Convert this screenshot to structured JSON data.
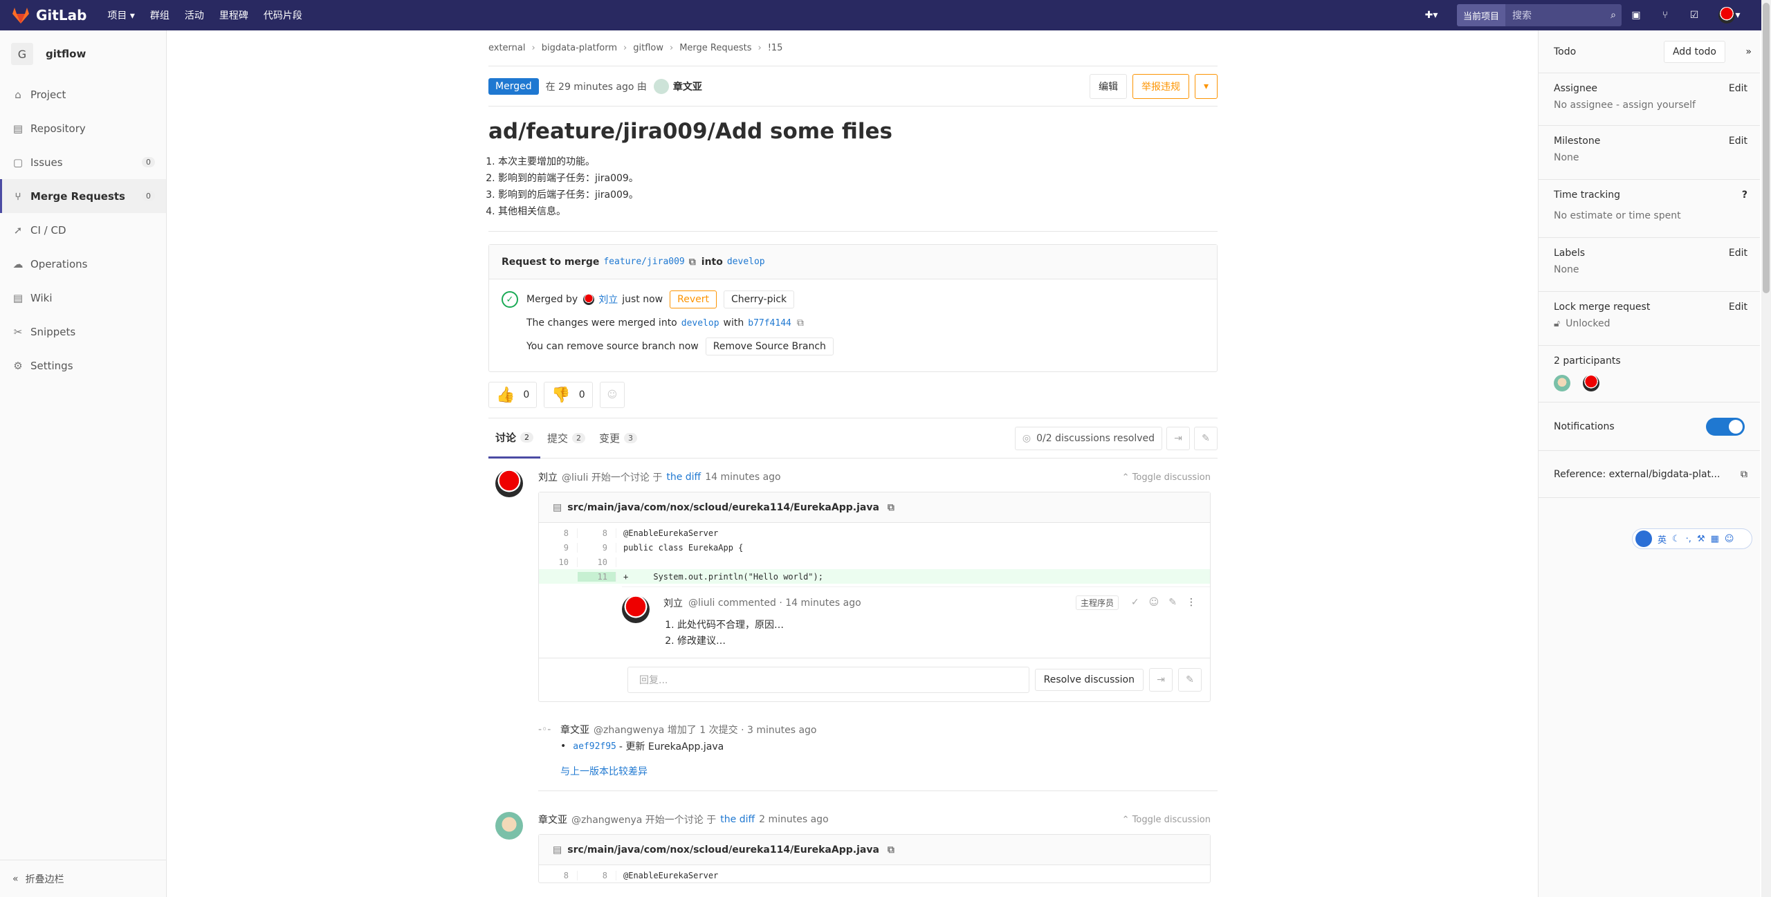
{
  "nav": {
    "brand": "GitLab",
    "links": [
      "项目 ▾",
      "群组",
      "活动",
      "里程碑",
      "代码片段"
    ],
    "search_scope": "当前项目",
    "search_placeholder": "搜索"
  },
  "sidebar": {
    "project_initial": "G",
    "project_name": "gitflow",
    "items": [
      {
        "label": "Project",
        "icon": "home-icon"
      },
      {
        "label": "Repository",
        "icon": "book-icon"
      },
      {
        "label": "Issues",
        "icon": "issues-icon",
        "count": "0"
      },
      {
        "label": "Merge Requests",
        "icon": "merge-request-icon",
        "count": "0"
      },
      {
        "label": "CI / CD",
        "icon": "rocket-icon"
      },
      {
        "label": "Operations",
        "icon": "cloud-gear-icon"
      },
      {
        "label": "Wiki",
        "icon": "book-icon"
      },
      {
        "label": "Snippets",
        "icon": "scissors-icon"
      },
      {
        "label": "Settings",
        "icon": "gear-icon"
      }
    ],
    "collapse_label": "折叠边栏"
  },
  "breadcrumb": [
    "external",
    "bigdata-platform",
    "gitflow",
    "Merge Requests",
    "!15"
  ],
  "mr": {
    "status": "Merged",
    "meta_prefix": "在 29 minutes ago 由",
    "author": "章文亚",
    "edit_btn": "编辑",
    "report_btn": "举报违规",
    "title": "ad/feature/jira009/Add some files",
    "description": [
      "本次主要增加的功能。",
      "影响到的前端子任务：jira009。",
      "影响到的后端子任务：jira009。",
      "其他相关信息。"
    ]
  },
  "widget": {
    "req_prefix": "Request to merge",
    "source_branch": "feature/jira009",
    "req_into": "into",
    "target_branch": "develop",
    "merged_by": "Merged by",
    "merger": "刘立",
    "merged_when": "just now",
    "revert": "Revert",
    "cherry": "Cherry-pick",
    "changes_text": "The changes were merged into",
    "changes_branch": "develop",
    "changes_with": "with",
    "commit_sha": "b77f4144",
    "remove_text": "You can remove source branch now",
    "remove_btn": "Remove Source Branch"
  },
  "awards": {
    "up": "0",
    "down": "0"
  },
  "tabs": [
    {
      "label": "讨论",
      "count": "2"
    },
    {
      "label": "提交",
      "count": "2"
    },
    {
      "label": "变更",
      "count": "3"
    }
  ],
  "resolved_text": "0/2 discussions resolved",
  "discussion1": {
    "author": "刘立",
    "handle": "@liuli 开始一个讨论 于",
    "diff_link": "the diff",
    "when": "14 minutes ago",
    "toggle": "Toggle discussion",
    "file": "src/main/java/com/nox/scloud/eureka114/EurekaApp.java",
    "lines": [
      {
        "old": "8",
        "new": "8",
        "code": "@EnableEurekaServer",
        "type": ""
      },
      {
        "old": "9",
        "new": "9",
        "code": "public class EurekaApp {",
        "type": ""
      },
      {
        "old": "10",
        "new": "10",
        "code": "",
        "type": ""
      },
      {
        "old": "",
        "new": "11",
        "code": "+     System.out.println(\"Hello world\");",
        "type": "add"
      }
    ],
    "note": {
      "author": "刘立",
      "meta": "@liuli commented · 14 minutes ago",
      "role": "主程序员",
      "items": [
        "此处代码不合理，原因…",
        "修改建议…"
      ]
    },
    "reply_placeholder": "回复...",
    "resolve_btn": "Resolve discussion"
  },
  "system_note": {
    "author": "章文亚",
    "meta": "@zhangwenya 增加了 1 次提交 · 3 minutes ago",
    "commit_sha": "aef92f95",
    "commit_msg": "- 更新 EurekaApp.java",
    "compare": "与上一版本比较差异"
  },
  "discussion2": {
    "author": "章文亚",
    "handle": "@zhangwenya 开始一个讨论 于",
    "diff_link": "the diff",
    "when": "2 minutes ago",
    "toggle": "Toggle discussion",
    "file": "src/main/java/com/nox/scloud/eureka114/EurekaApp.java",
    "first_line": {
      "old": "8",
      "new": "8",
      "code": "@EnableEurekaServer"
    }
  },
  "right": {
    "todo": "Todo",
    "add_todo": "Add todo",
    "assignee_title": "Assignee",
    "assignee_value": "No assignee - assign yourself",
    "milestone_title": "Milestone",
    "milestone_value": "None",
    "time_title": "Time tracking",
    "time_value": "No estimate or time spent",
    "labels_title": "Labels",
    "labels_value": "None",
    "lock_title": "Lock merge request",
    "lock_value": "Unlocked",
    "participants": "2 participants",
    "notifications": "Notifications",
    "reference": "Reference: external/bigdata-plat...",
    "edit": "Edit"
  },
  "ime": {
    "lang": "英"
  }
}
